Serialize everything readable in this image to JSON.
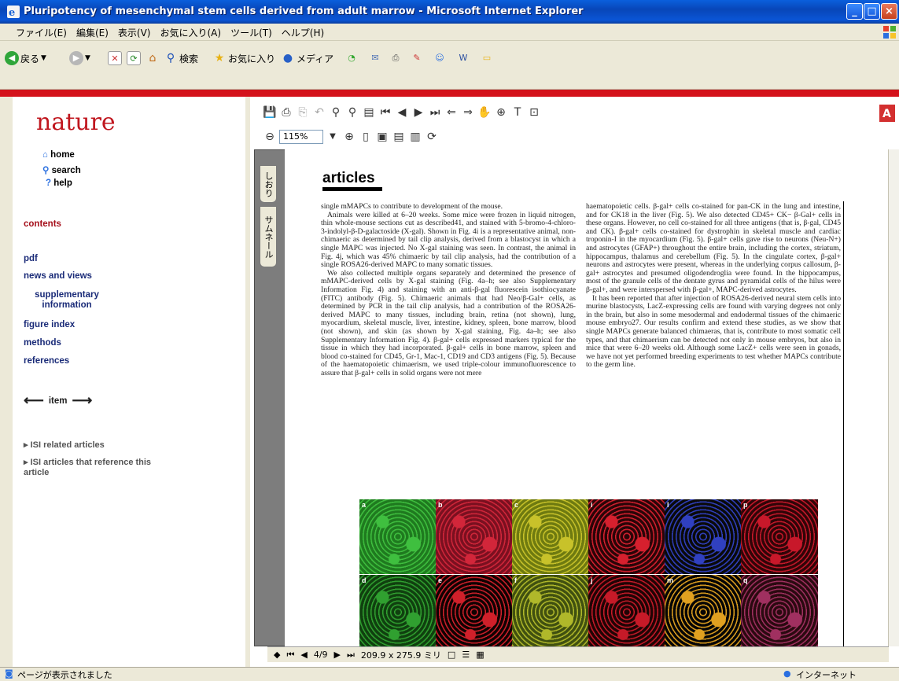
{
  "window": {
    "title": "Pluripotency of mesenchymal stem cells derived from adult marrow - Microsoft Internet Explorer"
  },
  "menu": [
    "ファイル(E)",
    "編集(E)",
    "表示(V)",
    "お気に入り(A)",
    "ツール(T)",
    "ヘルプ(H)"
  ],
  "toolbar": {
    "back": "戻る",
    "search": "検索",
    "favorites": "お気に入り",
    "media": "メディア"
  },
  "sidebar": {
    "logo": "nature",
    "home": "home",
    "search": "search",
    "help": "help",
    "contents": "contents",
    "pdf": "pdf",
    "news_views": "news and views",
    "supplementary": "supplementary information",
    "figure_index": "figure index",
    "methods": "methods",
    "references": "references",
    "item": "item",
    "isi_related": "ISI related articles",
    "isi_reference": "ISI articles that reference this article"
  },
  "viewer": {
    "zoom": "115%",
    "page_current": "4/9",
    "page_size": "209.9 x 275.9 ミリ",
    "sidetab_bookmarks": "しおり",
    "sidetab_thumbnails": "サムネール"
  },
  "article": {
    "heading": "articles",
    "left_col": [
      "single mMAPCs to contribute to development of the mouse.",
      "Animals were killed at 6–20 weeks. Some mice were frozen in liquid nitrogen, thin whole-mouse sections cut as described41, and stained with 5-bromo-4-chloro-3-indolyl-β-D-galactoside (X-gal). Shown in Fig. 4i is a representative animal, non-chimaeric as determined by tail clip analysis, derived from a blastocyst in which a single MAPC was injected. No X-gal staining was seen. In contrast, the animal in Fig. 4j, which was 45% chimaeric by tail clip analysis, had the contribution of a single ROSA26-derived MAPC to many somatic tissues.",
      "We also collected multiple organs separately and determined the presence of mMAPC-derived cells by X-gal staining (Fig. 4a–h; see also Supplementary Information Fig. 4) and staining with an anti-β-gal fluorescein isothiocyanate (FITC) antibody (Fig. 5). Chimaeric animals that had Neo/β-Gal+ cells, as determined by PCR in the tail clip analysis, had a contribution of the ROSA26-derived MAPC to many tissues, including brain, retina (not shown), lung, myocardium, skeletal muscle, liver, intestine, kidney, spleen, bone marrow, blood (not shown), and skin (as shown by X-gal staining, Fig. 4a–h; see also Supplementary Information Fig. 4). β-gal+ cells expressed markers typical for the tissue in which they had incorporated. β-gal+ cells in bone marrow, spleen and blood co-stained for CD45, Gr-1, Mac-1, CD19 and CD3 antigens (Fig. 5). Because of the haematopoietic chimaerism, we used triple-colour immunofluorescence to assure that β-gal+ cells in solid organs were not mere"
    ],
    "right_col": [
      "haematopoietic cells. β-gal+ cells co-stained for pan-CK in the lung and intestine, and for CK18 in the liver (Fig. 5). We also detected CD45+ CK− β-Gal+ cells in these organs. However, no cell co-stained for all three antigens (that is, β-gal, CD45 and CK). β-gal+ cells co-stained for dystrophin in skeletal muscle and cardiac troponin-I in the myocardium (Fig. 5). β-gal+ cells gave rise to neurons (Neu-N+) and astrocytes (GFAP+) throughout the entire brain, including the cortex, striatum, hippocampus, thalamus and cerebellum (Fig. 5). In the cingulate cortex, β-gal+ neurons and astrocytes were present, whereas in the underlying corpus callosum, β-gal+ astrocytes and presumed oligodendroglia were found. In the hippocampus, most of the granule cells of the dentate gyrus and pyramidal cells of the hilus were β-gal+, and were interspersed with β-gal+, MAPC-derived astrocytes.",
      "It has been reported that after injection of ROSA26-derived neural stem cells into murine blastocysts, LacZ-expressing cells are found with varying degrees not only in the brain, but also in some mesodermal and endodermal tissues of the chimaeric mouse embryo27. Our results confirm and extend these studies, as we show that single MAPCs generate balanced chimaeras, that is, contribute to most somatic cell types, and that chimaerism can be detected not only in mouse embryos, but also in mice that were 6–20 weeks old. Although some LacZ+ cells were seen in gonads, we have not yet performed breeding experiments to test whether MAPCs contribute to the germ line."
    ],
    "figure_labels": [
      "a",
      "b",
      "c",
      "i",
      "l",
      "p",
      "d",
      "e",
      "f",
      "j",
      "m",
      "q"
    ]
  },
  "status": {
    "message": "ページが表示されました",
    "zone": "インターネット"
  },
  "colors": {
    "nature_red": "#c0161e",
    "stripe_red": "#d4121b",
    "nav_navy": "#1a2b78"
  }
}
